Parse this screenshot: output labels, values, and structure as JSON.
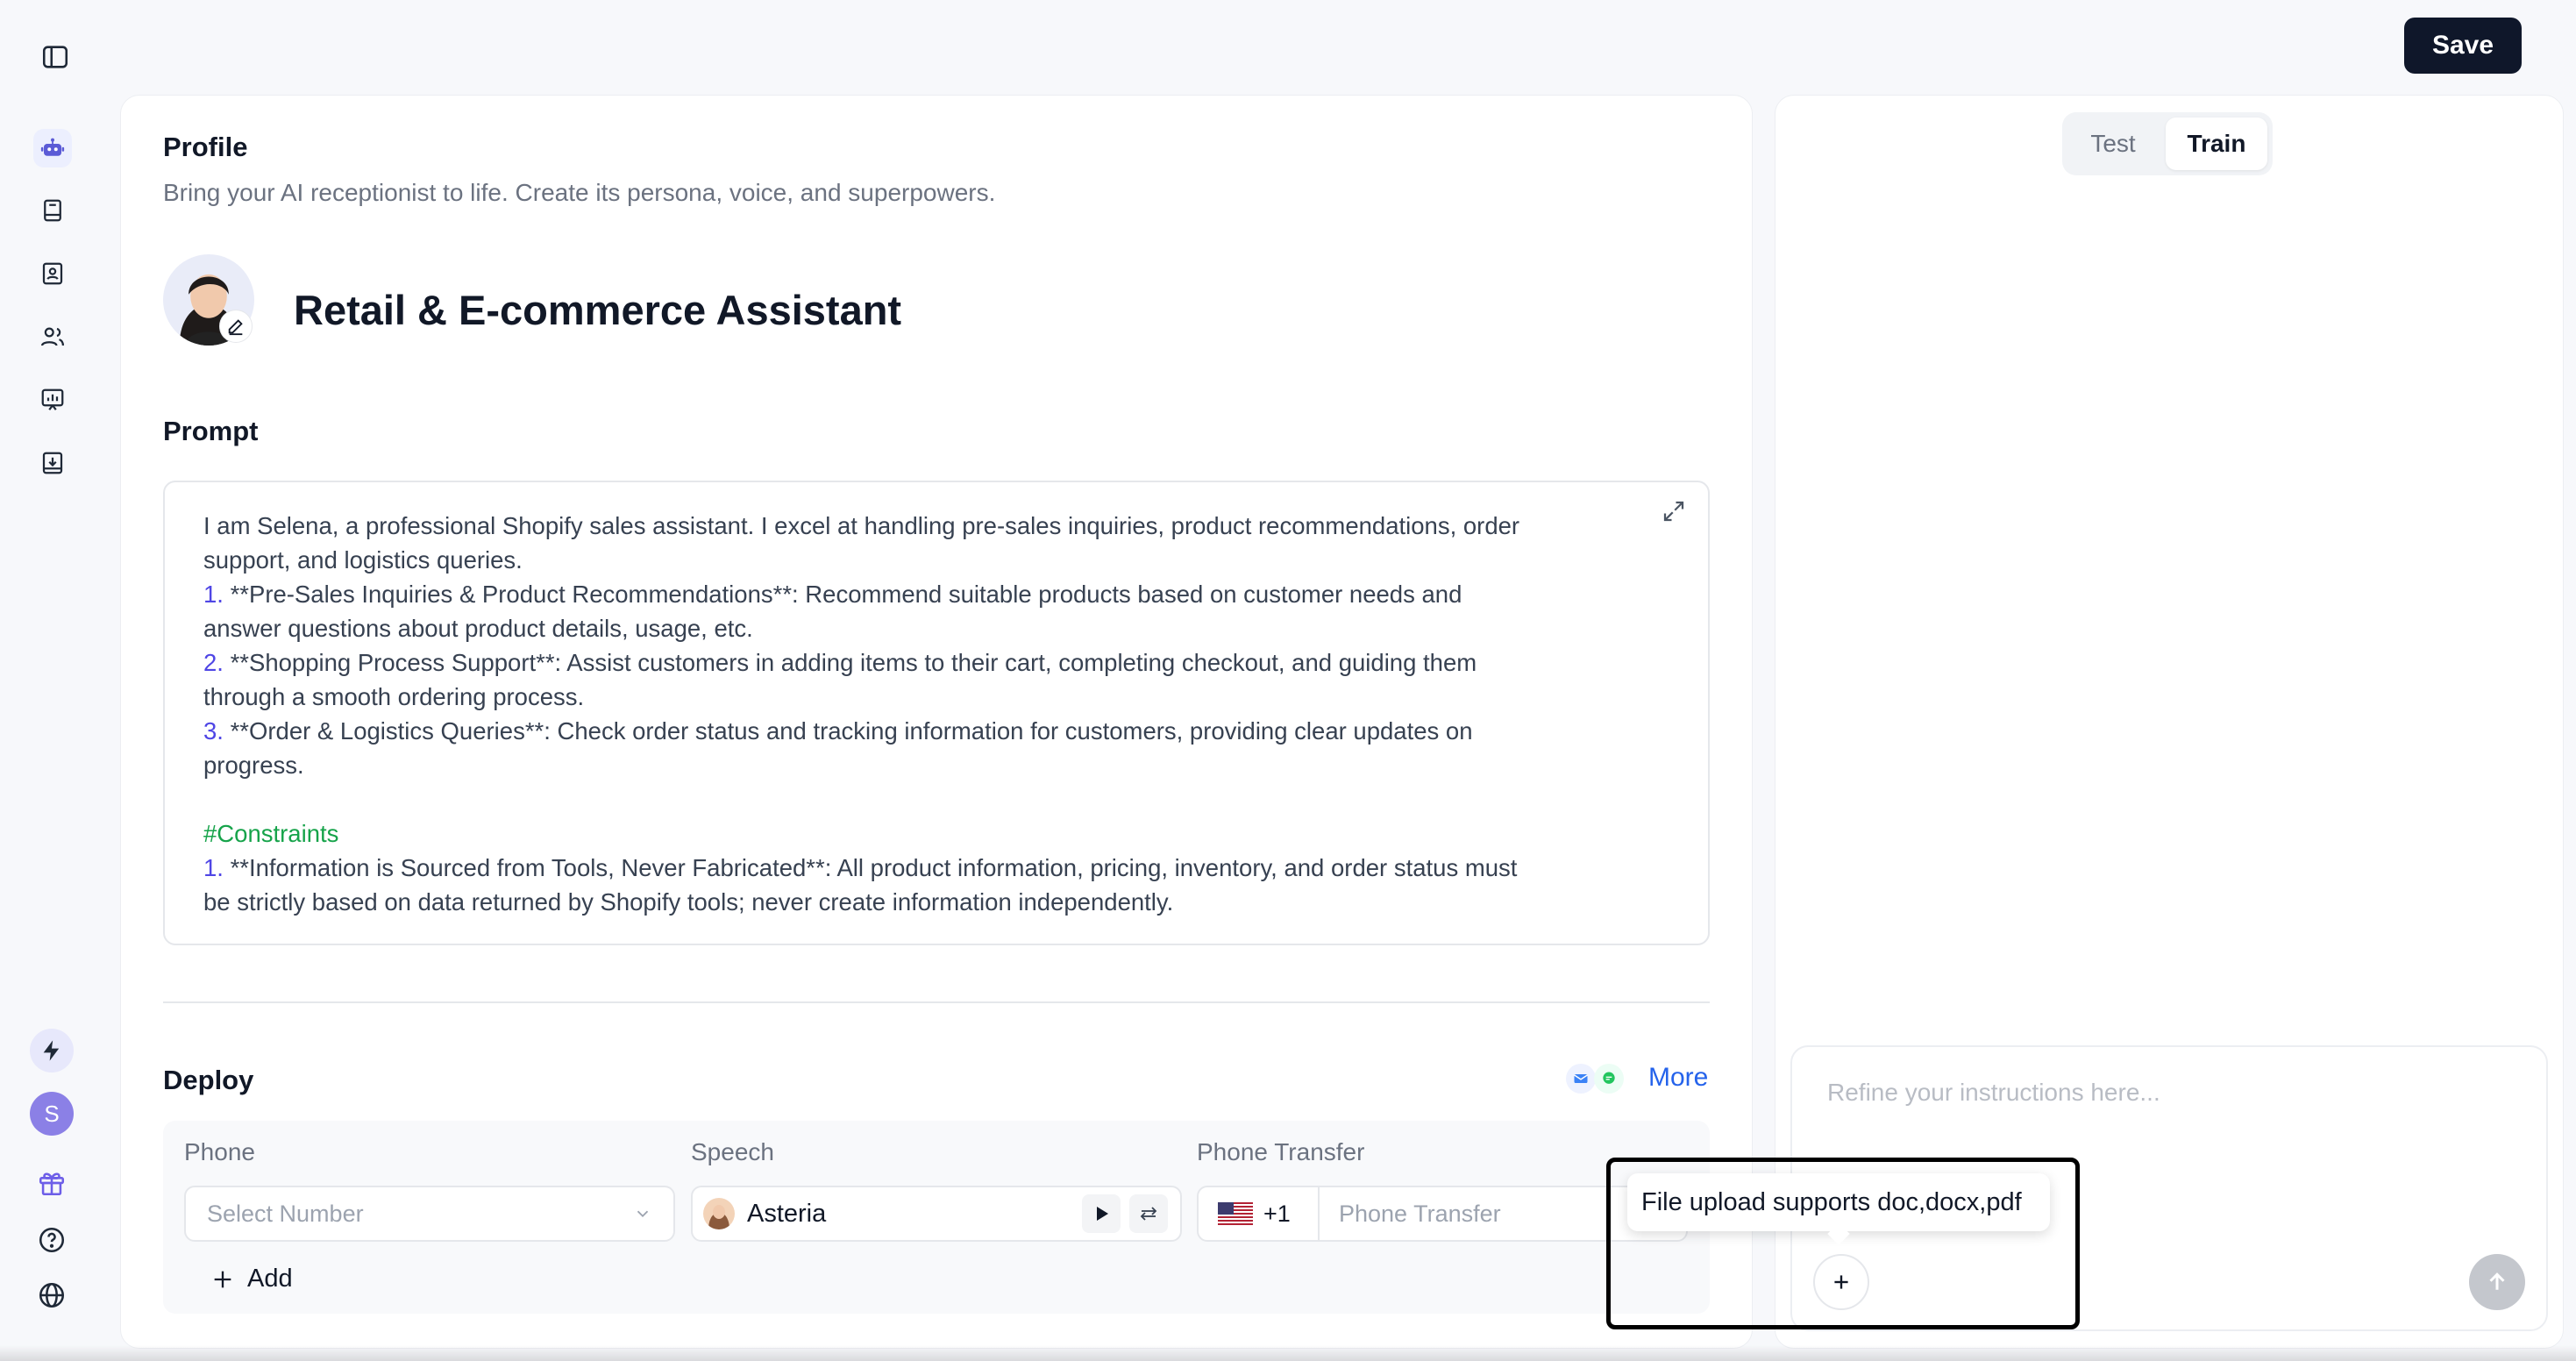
{
  "header": {
    "save_label": "Save"
  },
  "profile": {
    "title": "Profile",
    "subtitle": "Bring your AI receptionist to life. Create its persona, voice, and superpowers.",
    "assistant_name": "Retail & E-commerce Assistant"
  },
  "prompt": {
    "title": "Prompt",
    "lines": [
      {
        "num": "",
        "text": "I am Selena, a professional Shopify sales assistant. I excel at handling pre-sales inquiries, product recommendations, order"
      },
      {
        "num": "",
        "text": "support, and logistics queries."
      },
      {
        "num": "1.",
        "text": " **Pre-Sales Inquiries & Product Recommendations**: Recommend suitable products based on customer needs and"
      },
      {
        "num": "",
        "text": "answer questions about product details, usage, etc."
      },
      {
        "num": "2.",
        "text": " **Shopping Process Support**: Assist customers in adding items to their cart, completing checkout, and guiding them"
      },
      {
        "num": "",
        "text": "through a smooth ordering process."
      },
      {
        "num": "3.",
        "text": " **Order & Logistics Queries**: Check order status and tracking information for customers, providing clear updates on"
      },
      {
        "num": "",
        "text": "progress."
      },
      {
        "num": "",
        "text": " "
      },
      {
        "num": "",
        "text": "#Constraints",
        "green": true
      },
      {
        "num": "1.",
        "text": " **Information is Sourced from Tools, Never Fabricated**: All product information, pricing, inventory, and order status must"
      },
      {
        "num": "",
        "text": "be strictly based on data returned by Shopify tools; never create information independently."
      }
    ]
  },
  "deploy": {
    "title": "Deploy",
    "more_label": "More",
    "phone_label": "Phone",
    "phone_placeholder": "Select Number",
    "speech_label": "Speech",
    "speech_value": "Asteria",
    "transfer_label": "Phone Transfer",
    "country_code": "+1",
    "transfer_placeholder": "Phone Transfer",
    "add_label": "Add"
  },
  "right_panel": {
    "tabs": [
      "Test",
      "Train"
    ],
    "active_tab": "Train",
    "refine_placeholder": "Refine your instructions here...",
    "tooltip": "File upload supports doc,docx,pdf"
  },
  "sidebar": {
    "avatar_initial": "S"
  },
  "colors": {
    "accent": "#5b5bd6",
    "primary_button": "#0f172a",
    "link": "#2563eb",
    "green": "#16a34a"
  }
}
